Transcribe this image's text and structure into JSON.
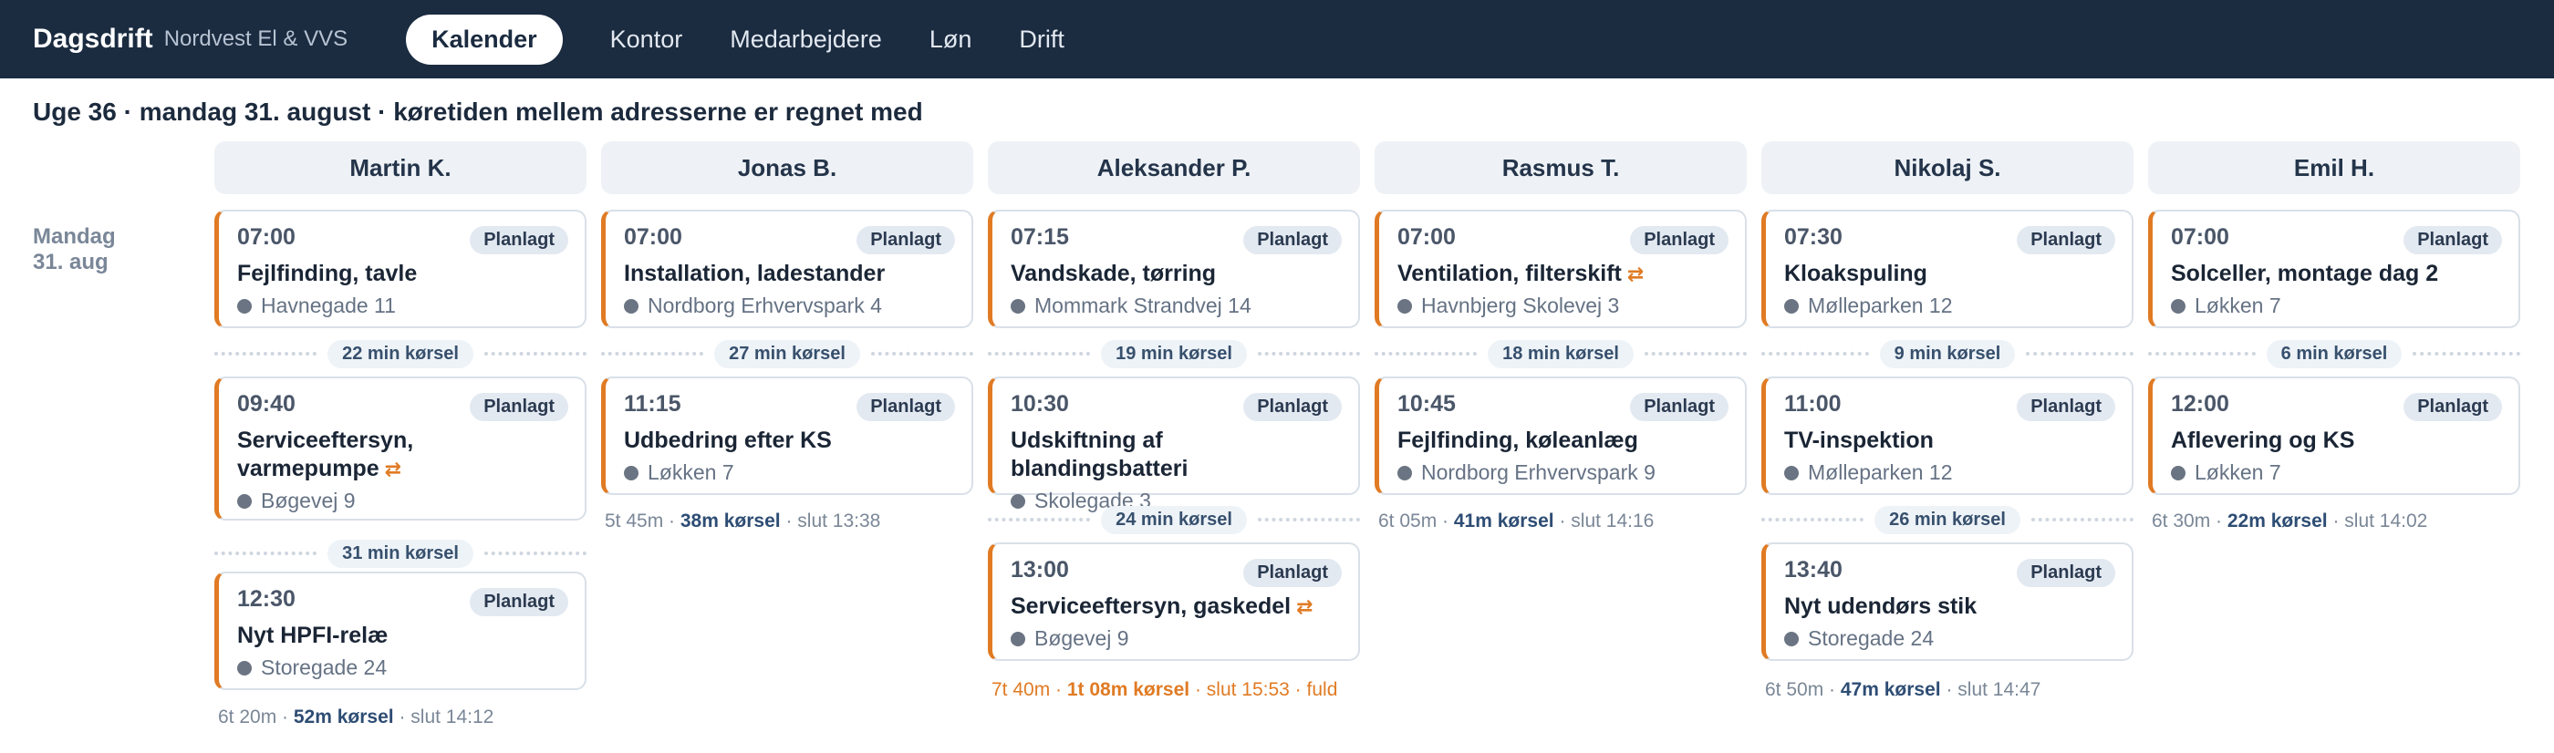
{
  "app": {
    "brand": "Dagsdrift",
    "company": "Nordvest El & VVS"
  },
  "nav": [
    {
      "label": "Kalender",
      "active": true
    },
    {
      "label": "Kontor"
    },
    {
      "label": "Medarbejdere"
    },
    {
      "label": "Løn"
    },
    {
      "label": "Drift"
    }
  ],
  "page": {
    "title": "Uge 36 · mandag 31. august · køretiden mellem adresserne er regnet med"
  },
  "day": {
    "weekday": "Mandag",
    "date": "31. aug"
  },
  "colors": {
    "accent": "#e07b24",
    "header_bg": "#1b2b40",
    "badge_bg": "#e3e9f1"
  },
  "columns": [
    {
      "name": "Martin K.",
      "jobs": [
        {
          "time": "07:00",
          "status": "Planlagt",
          "title": "Fejlfinding, tavle",
          "address": "Havnegade 11",
          "repeat": false
        },
        {
          "time": "09:40",
          "status": "Planlagt",
          "title": "Serviceeftersyn, varmepumpe",
          "address": "Bøgevej 9",
          "repeat": true
        },
        {
          "time": "12:30",
          "status": "Planlagt",
          "title": "Nyt HPFI-relæ",
          "address": "Storegade 24",
          "repeat": false
        }
      ],
      "drives": [
        "22 min kørsel",
        "31 min kørsel"
      ],
      "summary": {
        "work": "6t 20m · ",
        "drive": "52m kørsel",
        "end": " · slut 14:12",
        "full": false
      }
    },
    {
      "name": "Jonas B.",
      "jobs": [
        {
          "time": "07:00",
          "status": "Planlagt",
          "title": "Installation, ladestander",
          "address": "Nordborg Erhvervspark 4",
          "repeat": false
        },
        {
          "time": "11:15",
          "status": "Planlagt",
          "title": "Udbedring efter KS",
          "address": "Løkken 7",
          "repeat": false
        }
      ],
      "drives": [
        "27 min kørsel"
      ],
      "summary": {
        "work": "5t 45m · ",
        "drive": "38m kørsel",
        "end": " · slut 13:38",
        "full": false
      }
    },
    {
      "name": "Aleksander P.",
      "jobs": [
        {
          "time": "07:15",
          "status": "Planlagt",
          "title": "Vandskade, tørring",
          "address": "Mommark Strandvej 14",
          "repeat": false
        },
        {
          "time": "10:30",
          "status": "Planlagt",
          "title": "Udskiftning af blandingsbatteri",
          "address": "Skolegade 3",
          "repeat": false
        },
        {
          "time": "13:00",
          "status": "Planlagt",
          "title": "Serviceeftersyn, gaskedel",
          "address": "Bøgevej 9",
          "repeat": true
        }
      ],
      "drives": [
        "19 min kørsel",
        "24 min kørsel"
      ],
      "summary": {
        "work": "7t 40m · ",
        "drive": "1t 08m kørsel",
        "end": " · slut 15:53 · fuld",
        "full": true
      }
    },
    {
      "name": "Rasmus T.",
      "jobs": [
        {
          "time": "07:00",
          "status": "Planlagt",
          "title": "Ventilation, filterskift",
          "address": "Havnbjerg Skolevej 3",
          "repeat": true
        },
        {
          "time": "10:45",
          "status": "Planlagt",
          "title": "Fejlfinding, køleanlæg",
          "address": "Nordborg Erhvervspark 9",
          "repeat": false
        }
      ],
      "drives": [
        "18 min kørsel"
      ],
      "summary": {
        "work": "6t 05m · ",
        "drive": "41m kørsel",
        "end": " · slut 14:16",
        "full": false
      }
    },
    {
      "name": "Nikolaj S.",
      "jobs": [
        {
          "time": "07:30",
          "status": "Planlagt",
          "title": "Kloakspuling",
          "address": "Mølleparken 12",
          "repeat": false
        },
        {
          "time": "11:00",
          "status": "Planlagt",
          "title": "TV-inspektion",
          "address": "Mølleparken 12",
          "repeat": false
        },
        {
          "time": "13:40",
          "status": "Planlagt",
          "title": "Nyt udendørs stik",
          "address": "Storegade 24",
          "repeat": false
        }
      ],
      "drives": [
        "9 min kørsel",
        "26 min kørsel"
      ],
      "summary": {
        "work": "6t 50m · ",
        "drive": "47m kørsel",
        "end": " · slut 14:47",
        "full": false
      }
    },
    {
      "name": "Emil H.",
      "jobs": [
        {
          "time": "07:00",
          "status": "Planlagt",
          "title": "Solceller, montage dag 2",
          "address": "Løkken 7",
          "repeat": false
        },
        {
          "time": "12:00",
          "status": "Planlagt",
          "title": "Aflevering og KS",
          "address": "Løkken 7",
          "repeat": false
        }
      ],
      "drives": [
        "6 min kørsel"
      ],
      "summary": {
        "work": "6t 30m · ",
        "drive": "22m kørsel",
        "end": " · slut 14:02",
        "full": false
      }
    }
  ]
}
